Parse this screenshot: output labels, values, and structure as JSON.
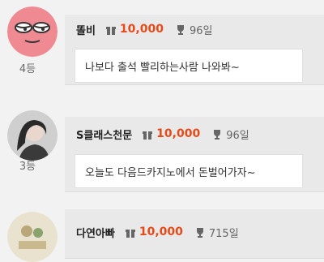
{
  "entries": [
    {
      "rank": "4등",
      "nickname": "똘비",
      "points": "10,000",
      "days": "96일",
      "message": "나보다 출석 빨리하는사람 나와봐~"
    },
    {
      "rank": "3등",
      "nickname": "S클래스천문",
      "points": "10,000",
      "days": "96일",
      "message": "오늘도 다음드카지노에서 돈벌어가자~"
    },
    {
      "rank": "",
      "nickname": "다연아빠",
      "points": "10,000",
      "days": "715일",
      "message": ""
    }
  ],
  "colors": {
    "points": "#e64a19",
    "background": "#f2f2f2",
    "card": "#e9e9e9"
  }
}
